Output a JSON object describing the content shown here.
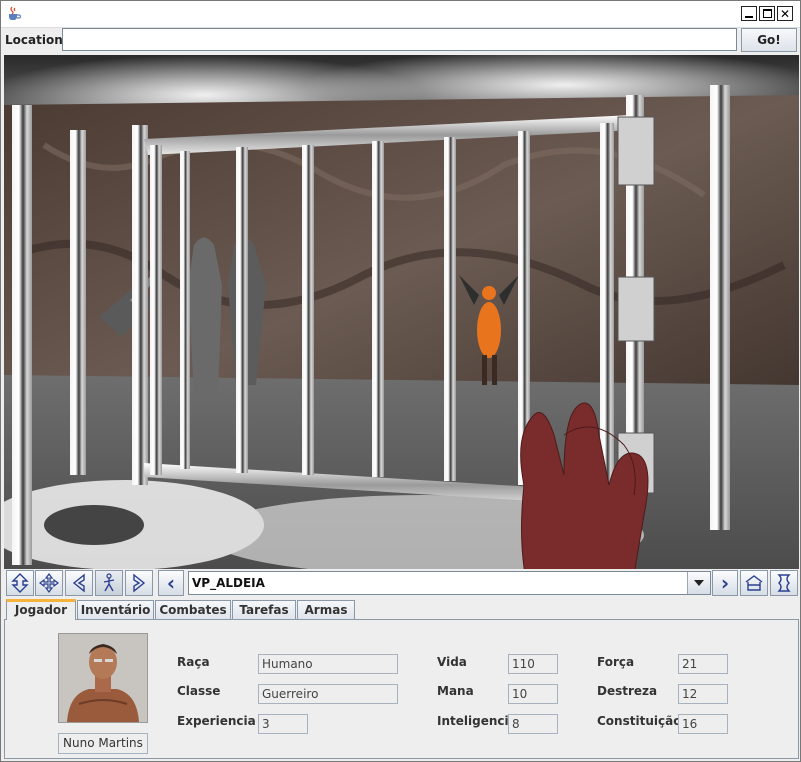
{
  "window": {
    "close_glyph": "✕"
  },
  "location_bar": {
    "label": "Location:",
    "url_value": "",
    "go_label": "Go!"
  },
  "navigation": {
    "buttons_left": [
      "move-up-down-icon",
      "move-all-directions-icon",
      "turn-left-icon",
      "walk-icon",
      "turn-right-icon"
    ],
    "back_glyph": "‹",
    "current_viewpoint": "VP_ALDEIA",
    "forward_glyph": "›",
    "buttons_right": [
      "home-icon",
      "map-icon"
    ]
  },
  "tabs": [
    {
      "label": "Jogador",
      "active": true
    },
    {
      "label": "Inventário",
      "active": false
    },
    {
      "label": "Combates",
      "active": false
    },
    {
      "label": "Tarefas",
      "active": false
    },
    {
      "label": "Armas",
      "active": false
    }
  ],
  "player": {
    "name": "Nuno Martins",
    "stats": {
      "raca": {
        "label": "Raça",
        "value": "Humano"
      },
      "classe": {
        "label": "Classe",
        "value": "Guerreiro"
      },
      "experiencia": {
        "label": "Experiencia",
        "value": "3"
      },
      "vida": {
        "label": "Vida",
        "value": "110"
      },
      "mana": {
        "label": "Mana",
        "value": "10"
      },
      "inteligencia": {
        "label": "Inteligencia",
        "value": "8"
      },
      "forca": {
        "label": "Força",
        "value": "21"
      },
      "destreza": {
        "label": "Destreza",
        "value": "12"
      },
      "constituicao": {
        "label": "Constituição",
        "value": "16"
      }
    }
  },
  "colors": {
    "accent_tab": "#f5b33c",
    "panel_bg": "#eeeeee",
    "hand": "#7a2c2c",
    "demon": "#e8741e"
  }
}
